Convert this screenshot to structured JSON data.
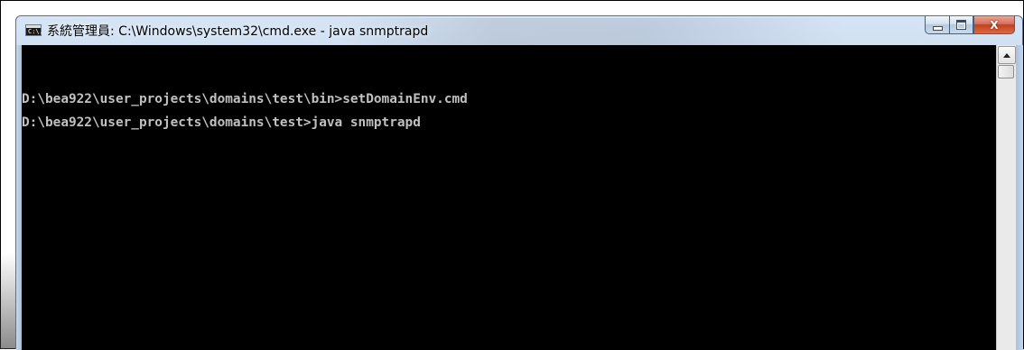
{
  "window": {
    "title": "系統管理員: C:\\Windows\\system32\\cmd.exe - java  snmptrapd",
    "icon": "cmd-console-icon",
    "icon_label": "C:\\."
  },
  "caption_buttons": {
    "minimize_icon": "minimize-icon",
    "maximize_icon": "maximize-icon",
    "close_icon": "close-icon",
    "close_glyph": "X"
  },
  "console": {
    "background": "#000000",
    "text_color": "#c0c0c0",
    "lines": [
      "D:\\bea922\\user_projects\\domains\\test\\bin>setDomainEnv.cmd",
      "D:\\bea922\\user_projects\\domains\\test>java snmptrapd"
    ]
  },
  "scrollbar": {
    "up_arrow_icon": "arrow-up-icon"
  }
}
